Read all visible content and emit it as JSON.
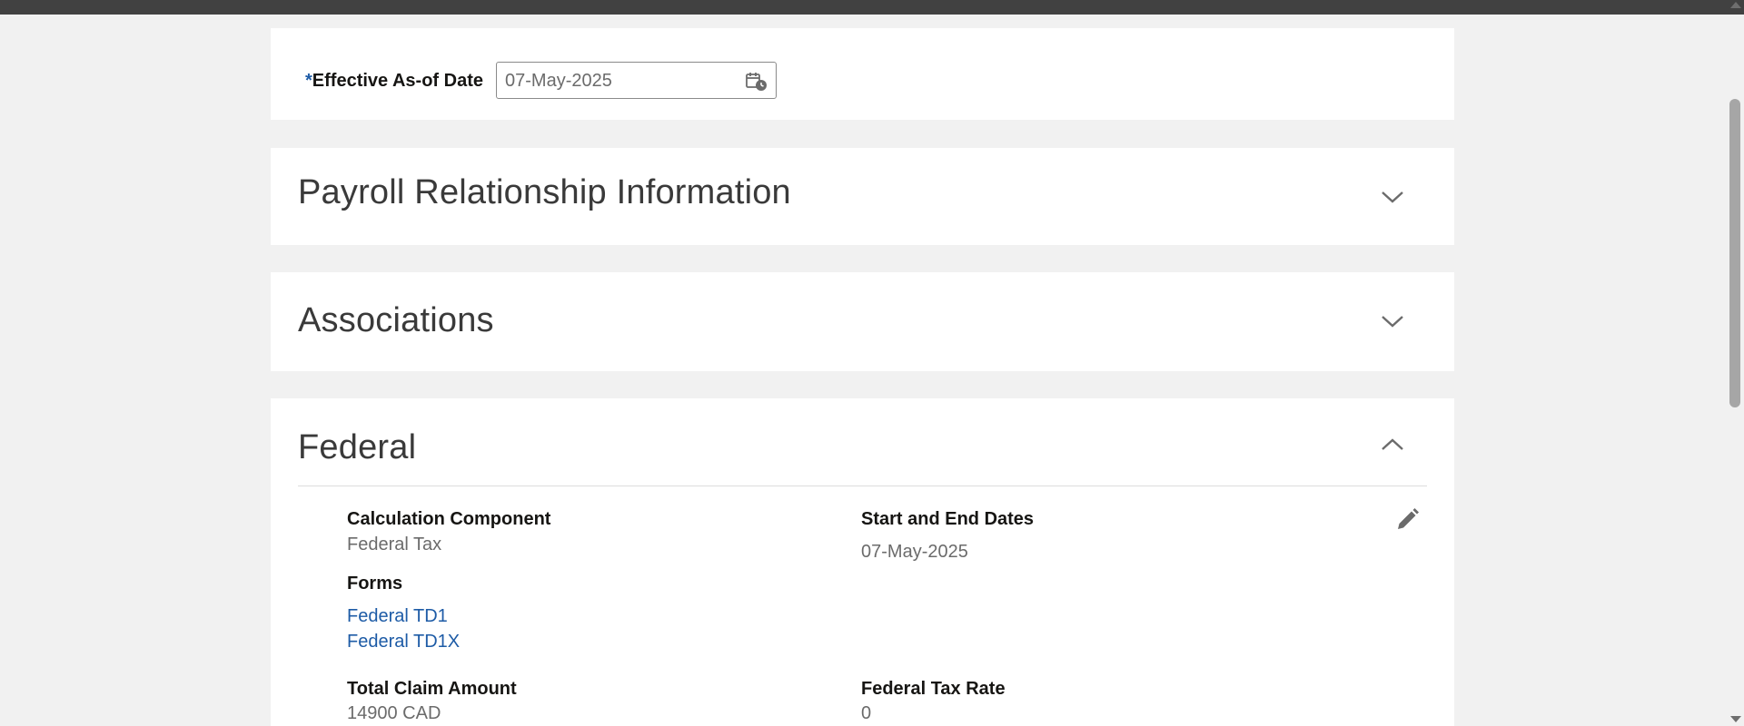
{
  "date_section": {
    "required_marker": "*",
    "label": "Effective As-of Date",
    "value": "07-May-2025"
  },
  "sections": {
    "payroll": {
      "title": "Payroll Relationship Information",
      "expanded": false
    },
    "associations": {
      "title": "Associations",
      "expanded": false
    },
    "federal": {
      "title": "Federal",
      "expanded": true
    }
  },
  "federal": {
    "calc_component_label": "Calculation Component",
    "calc_component_value": "Federal Tax",
    "start_end_label": "Start and End Dates",
    "start_end_value": "07-May-2025",
    "forms_label": "Forms",
    "forms": [
      "Federal TD1",
      "Federal TD1X"
    ],
    "total_claim_label": "Total Claim Amount",
    "total_claim_value": "14900 CAD",
    "tax_rate_label": "Federal Tax Rate",
    "tax_rate_value": "0"
  },
  "icons": {
    "date_picker": "calendar-clock-icon",
    "collapse": "chevron-down-icon",
    "expand": "chevron-up-icon",
    "edit": "pencil-icon"
  },
  "colors": {
    "link": "#1d5ba6",
    "required": "#1d5ba6",
    "background": "#f1f1f1",
    "card": "#ffffff"
  }
}
